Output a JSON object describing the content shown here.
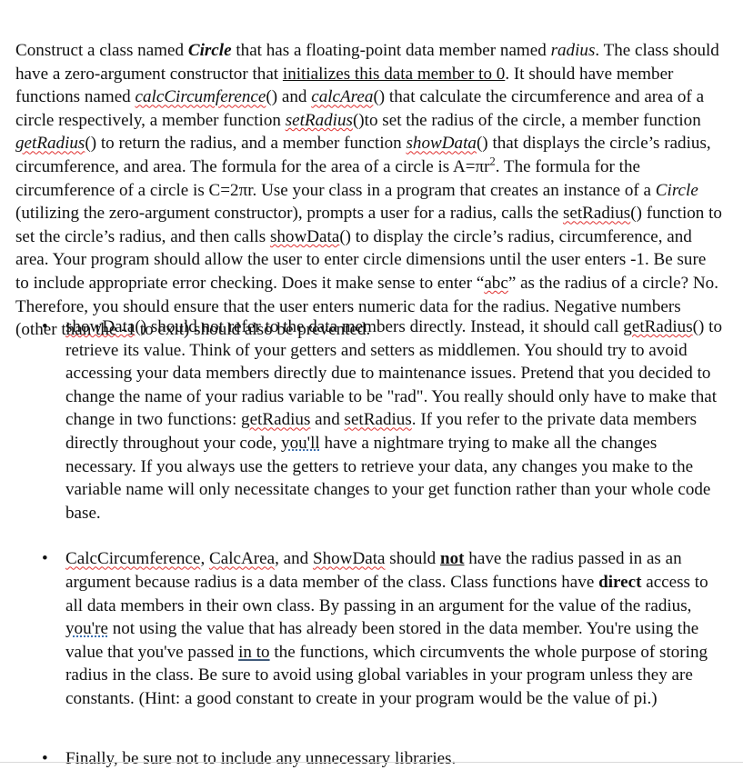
{
  "document": {
    "paragraph": {
      "seg_1": "Construct a class named ",
      "term_circle_1": "Circle",
      "seg_2": " that has a floating-point data member named ",
      "term_radius": "radius",
      "seg_3": ".  The class should have a zero-argument constructor that ",
      "underline_init": "initializes this data member to 0",
      "seg_4": ". It should have member functions named ",
      "fn_calcCircumference": "calcCircumference",
      "seg_5": "() and ",
      "fn_calcArea": "calcArea",
      "seg_6": "() that calculate the circumference and area of a circle respectively, a member function ",
      "fn_setRadius": "setRadius",
      "seg_7": "()to set the radius of the circle, a member function ",
      "fn_getRadius": "getRadius",
      "seg_8": "() to return the radius, and a member function ",
      "fn_showData": "showData",
      "seg_9": "() that displays the circle’s radius, circumference, and area. The formula for the area of a circle is A=πr",
      "sup_2": "2",
      "seg_10": ". The formula for the circumference of a circle is C=2πr. Use your class in a program that creates an instance of a ",
      "term_circle_2": "Circle",
      "seg_11": " (utilizing the zero-argument constructor), prompts a user for a radius, calls the ",
      "fn_setRadius_2": "setRadius",
      "seg_12": "() function to set the circle’s radius, and then calls ",
      "fn_showData_2": "showData",
      "seg_13": "() to display the circle’s radius, circumference, and area. Your program should allow the user to enter circle dimensions until the user enters -1.  Be sure to include appropriate error checking.  Does it make sense to enter “",
      "word_abc": "abc",
      "seg_14": "” as the radius of a circle?  No.  Therefore, you should ensure that the user enters numeric data for the radius.  Negative numbers (other than the -1 to exit) should also be prevented."
    },
    "bullets": [
      {
        "marker": "•",
        "seg_1": "",
        "fn_showData": "showData",
        "seg_2": "() should not refer to the data members directly.  Instead, it should call ",
        "fn_getRadius": "getRadius",
        "seg_3": "() to retrieve its value.  Think of your getters and setters as middlemen.  You should try to avoid accessing your data members directly due to maintenance issues.  Pretend that you decided to change the name of your radius variable to be \"rad\".  You really should only have to make that change in two functions:  ",
        "fn_getRadius_2": "getRadius",
        "seg_4": " and ",
        "fn_setRadius": "setRadius",
        "seg_5": ". If you refer to the private data members directly throughout your code, ",
        "word_youll": "you'll",
        "seg_6": " have a nightmare trying to make all the changes necessary.  If you always use the getters to retrieve your data, any changes you make to the variable name will only necessitate changes to your get function rather than your whole code base."
      },
      {
        "marker": "•",
        "fn_CalcCircumference": "CalcCircumference",
        "seg_1": ", ",
        "fn_CalcArea": "CalcArea",
        "seg_2": ", and ",
        "fn_ShowData": "ShowData",
        "seg_3": " should ",
        "word_not": "not",
        "seg_4": " have the radius passed in as an argument because radius is a data member of the class.  Class functions have ",
        "word_direct": "direct",
        "seg_5": " access to all data members in their own class.  By passing in an argument for the value of the radius, ",
        "word_youre": "you're",
        "seg_6": " not using the value that has already been stored in the data member. You're using the value that you've passed ",
        "word_into": "in to",
        "seg_7": " the functions, which circumvents the whole purpose of storing radius in the class. Be sure to avoid using global variables in your program unless they are constants.  (Hint: a good constant to create in your program would be the value of pi.)"
      },
      {
        "marker": "•",
        "text": "Finally, be sure not to include any unnecessary libraries."
      }
    ]
  },
  "colors": {
    "text": "#111111",
    "spellcheck_underline": "#e03030",
    "grammar_underline": "#3a6fb0",
    "edit_underline": "#405a7a",
    "page_background": "#ffffff",
    "rule": "#d9d9d9"
  }
}
